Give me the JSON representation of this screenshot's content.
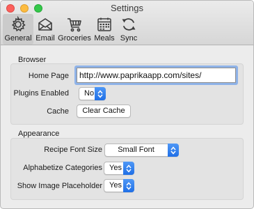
{
  "window": {
    "title": "Settings"
  },
  "toolbar": {
    "tabs": [
      {
        "label": "General",
        "icon": "gear-icon",
        "selected": true
      },
      {
        "label": "Email",
        "icon": "envelope-icon",
        "selected": false
      },
      {
        "label": "Groceries",
        "icon": "shopping-cart-icon",
        "selected": false
      },
      {
        "label": "Meals",
        "icon": "calendar-icon",
        "selected": false
      },
      {
        "label": "Sync",
        "icon": "sync-icon",
        "selected": false
      }
    ]
  },
  "browser": {
    "heading": "Browser",
    "home_page_label": "Home Page",
    "home_page_value": "http://www.paprikaapp.com/sites/",
    "plugins_label": "Plugins Enabled",
    "plugins_value": "No",
    "cache_label": "Cache",
    "clear_cache_label": "Clear Cache"
  },
  "appearance": {
    "heading": "Appearance",
    "font_size_label": "Recipe Font Size",
    "font_size_value": "Small Font",
    "alphabetize_label": "Alphabetize Categories",
    "alphabetize_value": "Yes",
    "placeholder_label": "Show Image Placeholder",
    "placeholder_value": "Yes"
  },
  "colors": {
    "accent": "#2a7bf0",
    "focus_ring": "#8fb3e8",
    "selected_tab": "#cbcbcb"
  }
}
